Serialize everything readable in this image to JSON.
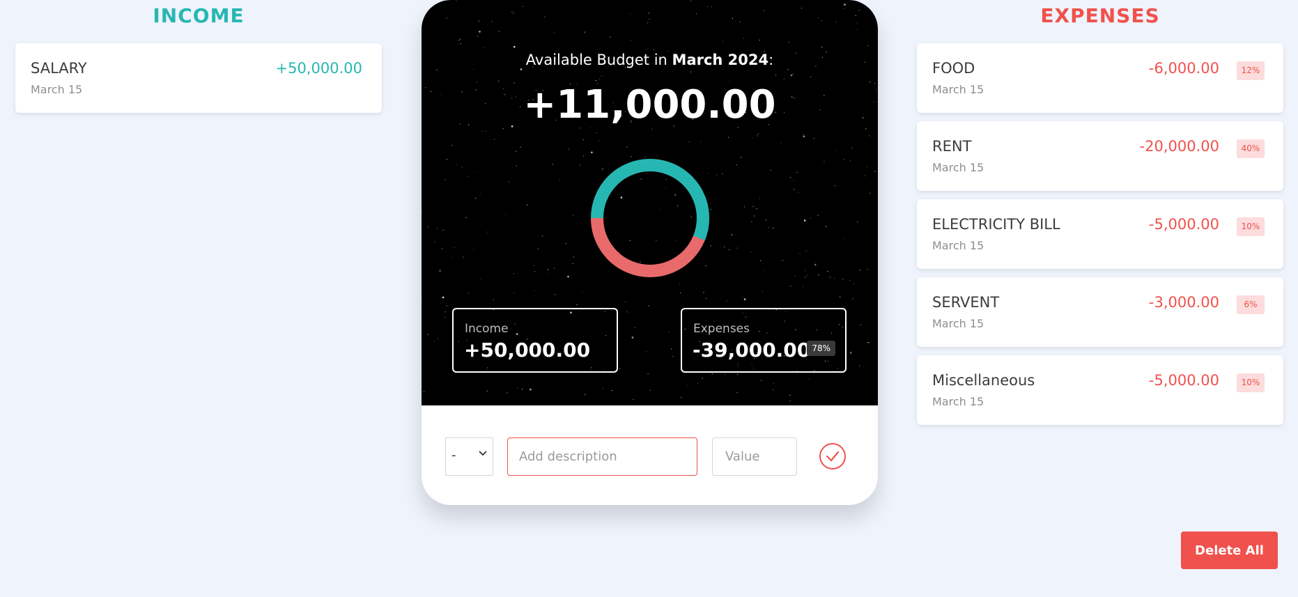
{
  "income": {
    "title": "INCOME",
    "items": [
      {
        "description": "SALARY",
        "date": "March 15",
        "value": "+50,000.00"
      }
    ]
  },
  "expenses": {
    "title": "EXPENSES",
    "items": [
      {
        "description": "FOOD",
        "date": "March 15",
        "value": "-6,000.00",
        "percent": "12%"
      },
      {
        "description": "RENT",
        "date": "March 15",
        "value": "-20,000.00",
        "percent": "40%"
      },
      {
        "description": "ELECTRICITY BILL",
        "date": "March 15",
        "value": "-5,000.00",
        "percent": "10%"
      },
      {
        "description": "SERVENT",
        "date": "March 15",
        "value": "-3,000.00",
        "percent": "6%"
      },
      {
        "description": "Miscellaneous",
        "date": "March 15",
        "value": "-5,000.00",
        "percent": "10%"
      }
    ]
  },
  "budget": {
    "heading_prefix": "Available Budget in",
    "month": "March 2024",
    "heading_suffix": ":",
    "amount": "+11,000.00",
    "income_label": "Income",
    "income_value": "+50,000.00",
    "expenses_label": "Expenses",
    "expenses_value": "-39,000.00",
    "expenses_percent": "78%"
  },
  "donut": {
    "income_total": 50000,
    "expenses_total": 39000,
    "income_color": "#27b7b3",
    "expenses_color": "#e96a6a"
  },
  "form": {
    "type_value": "-",
    "description_placeholder": "Add description",
    "value_placeholder": "Value",
    "submit_icon": "check-circle-icon"
  },
  "actions": {
    "delete_all_label": "Delete All"
  },
  "colors": {
    "income_accent": "#27b7b3",
    "expense_accent": "#f0514c",
    "background": "#eff3fc"
  }
}
